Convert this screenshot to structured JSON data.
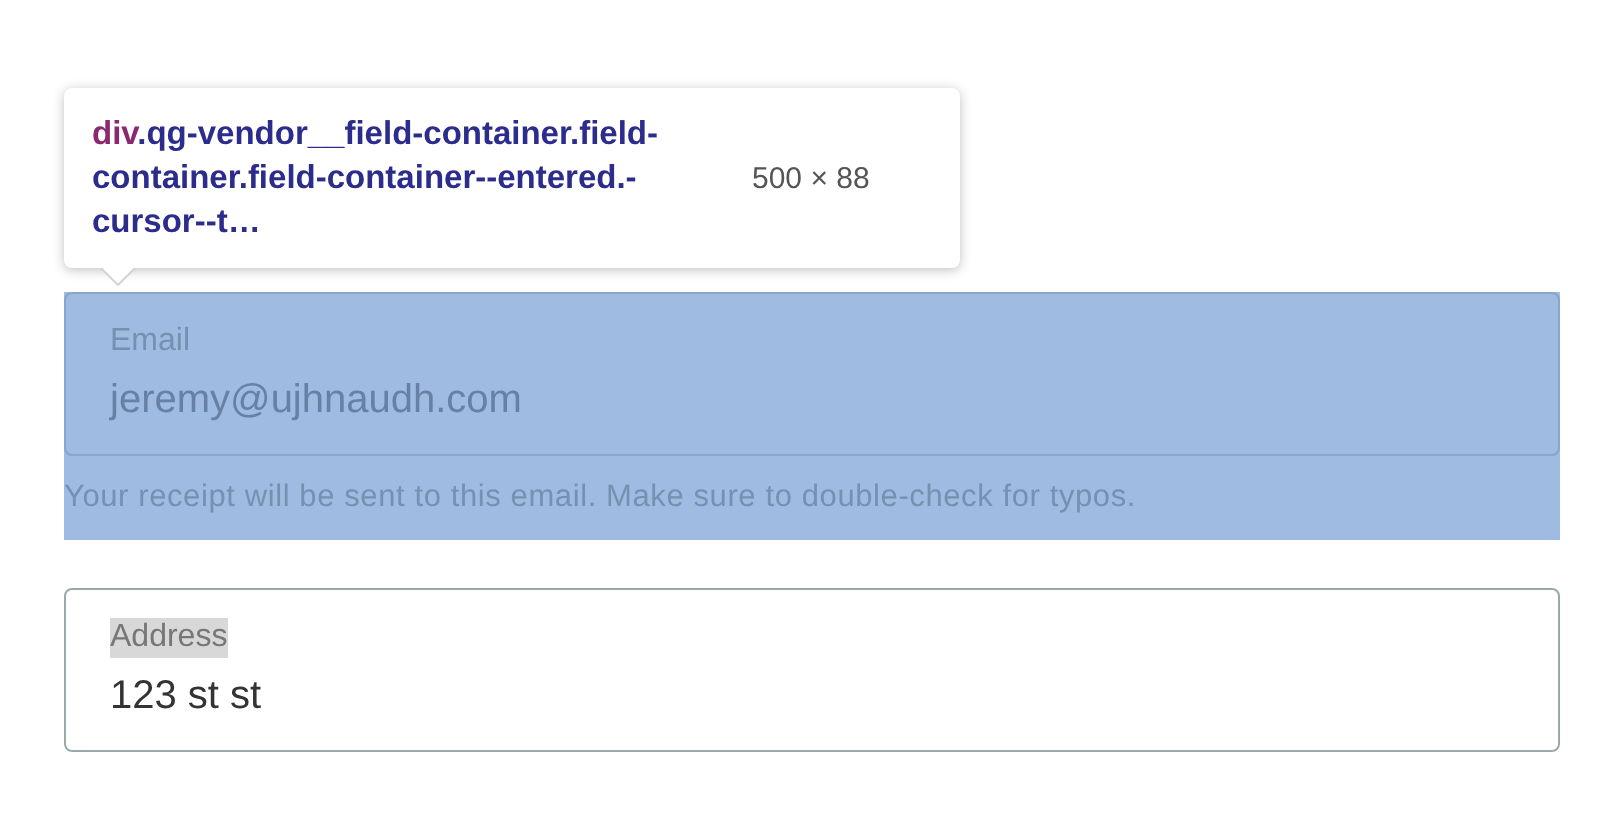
{
  "inspector_tooltip": {
    "tag": "div",
    "selector": ".qg-vendor__field-container.field-container.field-container--entered.-cursor--t…",
    "size": "500 × 88"
  },
  "fields": [
    {
      "label": "Email",
      "value": "jeremy@ujhnaudh.com",
      "hint": "Your receipt will be sent to this email. Make sure to double-check for typos.",
      "highlighted": true,
      "label_selected": false
    },
    {
      "label": "Address",
      "value": "123 st st",
      "highlighted": false,
      "label_selected": true
    }
  ]
}
